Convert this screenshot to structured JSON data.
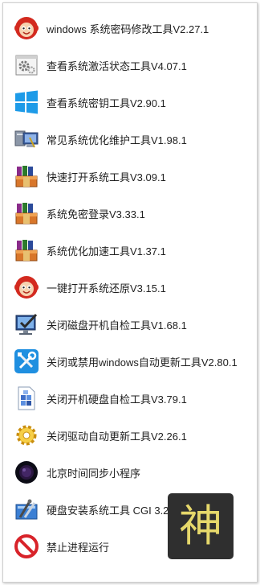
{
  "items": [
    {
      "label": "windows 系统密码修改工具V2.27.1",
      "icon": "red-cartoon-mascot-icon"
    },
    {
      "label": "查看系统激活状态工具V4.07.1",
      "icon": "gear-window-icon"
    },
    {
      "label": "查看系统密钥工具V2.90.1",
      "icon": "windows-logo-icon"
    },
    {
      "label": "常见系统优化维护工具V1.98.1",
      "icon": "computer-tools-icon"
    },
    {
      "label": "快速打开系统工具V3.09.1",
      "icon": "winrar-archive-icon"
    },
    {
      "label": "系统免密登录V3.33.1",
      "icon": "winrar-archive-icon"
    },
    {
      "label": "系统优化加速工具V1.37.1",
      "icon": "winrar-archive-icon"
    },
    {
      "label": "一键打开系统还原V3.15.1",
      "icon": "red-cartoon-mascot-icon"
    },
    {
      "label": "关闭磁盘开机自检工具V1.68.1",
      "icon": "monitor-check-icon"
    },
    {
      "label": "关闭或禁用windows自动更新工具V2.80.1",
      "icon": "wrench-screwdriver-icon"
    },
    {
      "label": "关闭开机硬盘自检工具V3.79.1",
      "icon": "document-blocks-icon"
    },
    {
      "label": "关闭驱动自动更新工具V2.26.1",
      "icon": "yellow-gear-icon"
    },
    {
      "label": "北京时间同步小程序",
      "icon": "dark-globe-icon"
    },
    {
      "label": "硬盘安装系统工具 CGI 3.2",
      "icon": "installer-tools-icon"
    },
    {
      "label": "禁止进程运行",
      "icon": "prohibited-icon"
    }
  ],
  "watermark": {
    "text": "神"
  }
}
